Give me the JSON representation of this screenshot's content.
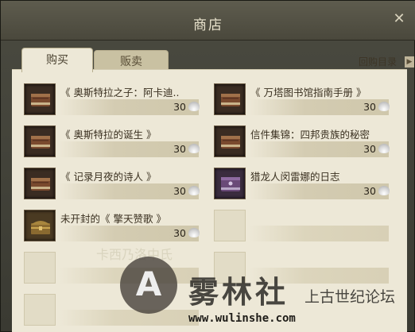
{
  "window": {
    "title": "商店",
    "close_label": "✕"
  },
  "tabs": [
    {
      "label": "购买",
      "active": true
    },
    {
      "label": "贩卖",
      "active": false
    }
  ],
  "buyback": {
    "label": "回购目录",
    "icon": "chevron-right-icon"
  },
  "items": [
    {
      "name": "《 奥斯特拉之子：阿卡迪..",
      "price": "30",
      "icon": "brown-book-icon"
    },
    {
      "name": "《 万塔图书馆指南手册 》",
      "price": "30",
      "icon": "brown-book-icon"
    },
    {
      "name": "《 奥斯特拉的诞生 》",
      "price": "30",
      "icon": "brown-book-icon"
    },
    {
      "name": "信件集锦：四邦贵族的秘密",
      "price": "30",
      "icon": "brown-book-icon"
    },
    {
      "name": "《 记录月夜的诗人 》",
      "price": "30",
      "icon": "brown-book-icon"
    },
    {
      "name": "猎龙人闵雷娜的日志",
      "price": "30",
      "icon": "purple-book-icon"
    },
    {
      "name": "未开封的《 擎天赞歌 》",
      "price": "30",
      "icon": "treasure-chest-icon"
    }
  ],
  "currency_icon": "shell-icon",
  "watermark": {
    "logo": "A",
    "title": "雾林社",
    "subtitle": "上古世纪论坛",
    "url": "www.wulinshe.com"
  },
  "faint_text": "卡西乃洛中氏"
}
